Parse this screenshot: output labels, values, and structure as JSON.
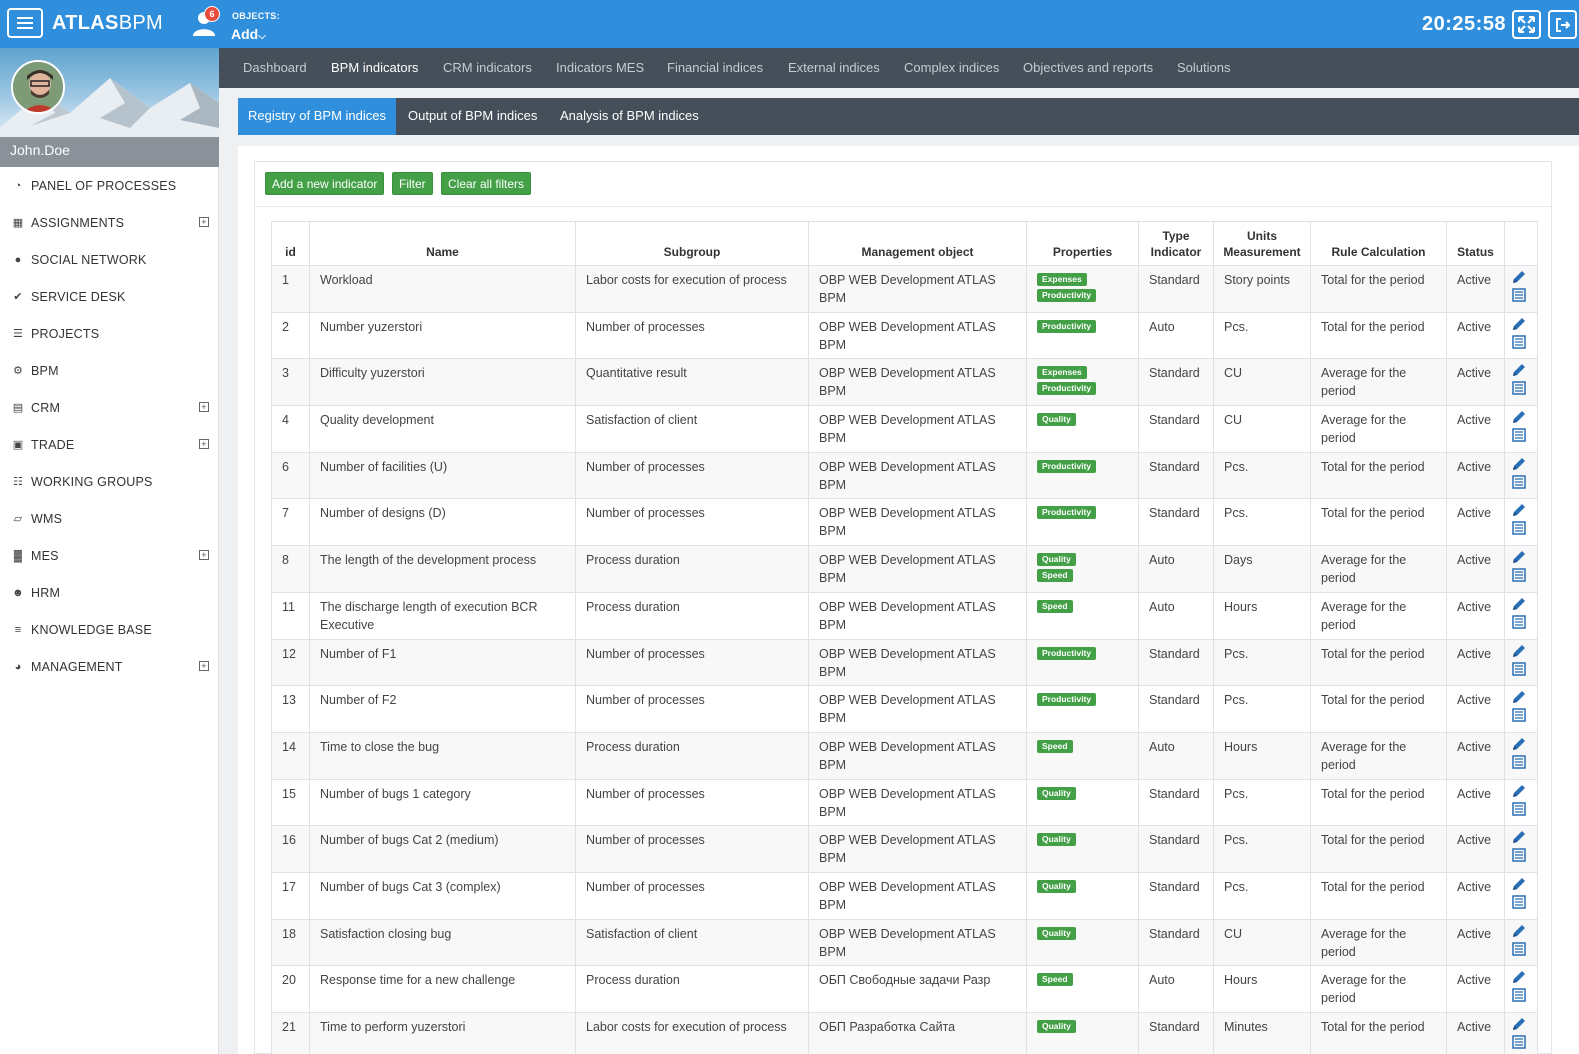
{
  "topbar": {
    "logo_bold": "ATLAS",
    "logo_light": "BPM",
    "notifications": "6",
    "objects_label": "OBJECTS:",
    "objects_add": "Add",
    "clock": "20:25:58"
  },
  "profile": {
    "username": "John.Doe"
  },
  "sidebar": {
    "items": [
      {
        "label": "PANEL OF PROCESSES",
        "icon": "dashboard-icon",
        "expandable": false
      },
      {
        "label": "ASSIGNMENTS",
        "icon": "calendar-icon",
        "expandable": true
      },
      {
        "label": "SOCIAL NETWORK",
        "icon": "comments-icon",
        "expandable": false
      },
      {
        "label": "SERVICE DESK",
        "icon": "check-icon",
        "expandable": false
      },
      {
        "label": "PROJECTS",
        "icon": "list-icon",
        "expandable": false
      },
      {
        "label": "BPM",
        "icon": "cogs-icon",
        "expandable": false
      },
      {
        "label": "CRM",
        "icon": "book-icon",
        "expandable": true
      },
      {
        "label": "TRADE",
        "icon": "money-icon",
        "expandable": true
      },
      {
        "label": "WORKING GROUPS",
        "icon": "sitemap-icon",
        "expandable": false
      },
      {
        "label": "WMS",
        "icon": "folder-open-icon",
        "expandable": false
      },
      {
        "label": "MES",
        "icon": "bar-chart-icon",
        "expandable": true
      },
      {
        "label": "HRM",
        "icon": "users-icon",
        "expandable": false
      },
      {
        "label": "KNOWLEDGE BASE",
        "icon": "database-icon",
        "expandable": false
      },
      {
        "label": "MANAGEMENT",
        "icon": "pie-chart-icon",
        "expandable": true
      }
    ]
  },
  "mainnav": {
    "tabs": [
      {
        "label": "Dashboard",
        "active": false
      },
      {
        "label": "BPM indicators",
        "active": true
      },
      {
        "label": "CRM indicators",
        "active": false
      },
      {
        "label": "Indicators MES",
        "active": false
      },
      {
        "label": "Financial indices",
        "active": false
      },
      {
        "label": "External indices",
        "active": false
      },
      {
        "label": "Complex indices",
        "active": false
      },
      {
        "label": "Objectives and reports",
        "active": false
      },
      {
        "label": "Solutions",
        "active": false
      }
    ]
  },
  "subnav": {
    "tabs": [
      {
        "label": "Registry of BPM indices",
        "active": true
      },
      {
        "label": "Output of BPM indices",
        "active": false
      },
      {
        "label": "Analysis of BPM indices",
        "active": false
      }
    ]
  },
  "toolbar": {
    "add_label": "Add a new indicator",
    "filter_label": "Filter",
    "clear_label": "Clear all filters"
  },
  "table": {
    "headers": {
      "id": "id",
      "name": "Name",
      "subgroup": "Subgroup",
      "management_object": "Management object",
      "properties": "Properties",
      "type_indicator": "Type Indicator",
      "units_measurement": "Units Measurement",
      "rule_calculation": "Rule Calculation",
      "status": "Status"
    },
    "rows": [
      {
        "id": "1",
        "name": "Workload",
        "subgroup": "Labor costs for execution of process",
        "object": "OBP WEB Development ATLAS BPM",
        "props": [
          "Expenses",
          "Productivity"
        ],
        "type": "Standard",
        "units": "Story points",
        "rule": "Total for the period",
        "status": "Active"
      },
      {
        "id": "2",
        "name": "Number yuzerstori",
        "subgroup": "Number of processes",
        "object": "OBP WEB Development ATLAS BPM",
        "props": [
          "Productivity"
        ],
        "type": "Auto",
        "units": "Pcs.",
        "rule": "Total for the period",
        "status": "Active"
      },
      {
        "id": "3",
        "name": "Difficulty yuzerstori",
        "subgroup": "Quantitative result",
        "object": "OBP WEB Development ATLAS BPM",
        "props": [
          "Expenses",
          "Productivity"
        ],
        "type": "Standard",
        "units": "CU",
        "rule": "Average for the period",
        "status": "Active"
      },
      {
        "id": "4",
        "name": "Quality development",
        "subgroup": "Satisfaction of client",
        "object": "OBP WEB Development ATLAS BPM",
        "props": [
          "Quality"
        ],
        "type": "Standard",
        "units": "CU",
        "rule": "Average for the period",
        "status": "Active"
      },
      {
        "id": "6",
        "name": "Number of facilities (U)",
        "subgroup": "Number of processes",
        "object": "OBP WEB Development ATLAS BPM",
        "props": [
          "Productivity"
        ],
        "type": "Standard",
        "units": "Pcs.",
        "rule": "Total for the period",
        "status": "Active"
      },
      {
        "id": "7",
        "name": "Number of designs (D)",
        "subgroup": "Number of processes",
        "object": "OBP WEB Development ATLAS BPM",
        "props": [
          "Productivity"
        ],
        "type": "Standard",
        "units": "Pcs.",
        "rule": "Total for the period",
        "status": "Active"
      },
      {
        "id": "8",
        "name": "The length of the development process",
        "subgroup": "Process duration",
        "object": "OBP WEB Development ATLAS BPM",
        "props": [
          "Quality",
          "Speed"
        ],
        "type": "Auto",
        "units": "Days",
        "rule": "Average for the period",
        "status": "Active"
      },
      {
        "id": "11",
        "name": "The discharge length of execution BCR Executive",
        "subgroup": "Process duration",
        "object": "OBP WEB Development ATLAS BPM",
        "props": [
          "Speed"
        ],
        "type": "Auto",
        "units": "Hours",
        "rule": "Average for the period",
        "status": "Active"
      },
      {
        "id": "12",
        "name": "Number of F1",
        "subgroup": "Number of processes",
        "object": "OBP WEB Development ATLAS BPM",
        "props": [
          "Productivity"
        ],
        "type": "Standard",
        "units": "Pcs.",
        "rule": "Total for the period",
        "status": "Active"
      },
      {
        "id": "13",
        "name": "Number of F2",
        "subgroup": "Number of processes",
        "object": "OBP WEB Development ATLAS BPM",
        "props": [
          "Productivity"
        ],
        "type": "Standard",
        "units": "Pcs.",
        "rule": "Total for the period",
        "status": "Active"
      },
      {
        "id": "14",
        "name": "Time to close the bug",
        "subgroup": "Process duration",
        "object": "OBP WEB Development ATLAS BPM",
        "props": [
          "Speed"
        ],
        "type": "Auto",
        "units": "Hours",
        "rule": "Average for the period",
        "status": "Active"
      },
      {
        "id": "15",
        "name": "Number of bugs 1 category",
        "subgroup": "Number of processes",
        "object": "OBP WEB Development ATLAS BPM",
        "props": [
          "Quality"
        ],
        "type": "Standard",
        "units": "Pcs.",
        "rule": "Total for the period",
        "status": "Active"
      },
      {
        "id": "16",
        "name": "Number of bugs Cat 2 (medium)",
        "subgroup": "Number of processes",
        "object": "OBP WEB Development ATLAS BPM",
        "props": [
          "Quality"
        ],
        "type": "Standard",
        "units": "Pcs.",
        "rule": "Total for the period",
        "status": "Active"
      },
      {
        "id": "17",
        "name": "Number of bugs Cat 3 (complex)",
        "subgroup": "Number of processes",
        "object": "OBP WEB Development ATLAS BPM",
        "props": [
          "Quality"
        ],
        "type": "Standard",
        "units": "Pcs.",
        "rule": "Total for the period",
        "status": "Active"
      },
      {
        "id": "18",
        "name": "Satisfaction closing bug",
        "subgroup": "Satisfaction of client",
        "object": "OBP WEB Development ATLAS BPM",
        "props": [
          "Quality"
        ],
        "type": "Standard",
        "units": "CU",
        "rule": "Average for the period",
        "status": "Active"
      },
      {
        "id": "20",
        "name": "Response time for a new challenge",
        "subgroup": "Process duration",
        "object": "ОБП Свободные задачи Разр",
        "props": [
          "Speed"
        ],
        "type": "Auto",
        "units": "Hours",
        "rule": "Average for the period",
        "status": "Active"
      },
      {
        "id": "21",
        "name": "Time to perform yuzerstori",
        "subgroup": "Labor costs for execution of process",
        "object": "ОБП Разработка Сайта",
        "props": [
          "Quality"
        ],
        "type": "Standard",
        "units": "Minutes",
        "rule": "Total for the period",
        "status": "Active"
      }
    ]
  },
  "colors": {
    "topbar": "#2f8fdc",
    "nav_dark": "#444f5a",
    "badge_green": "#43a047",
    "button_green": "#43a047",
    "notification_red": "#e74c3c",
    "edit_icon_blue": "#2a6fb5"
  }
}
